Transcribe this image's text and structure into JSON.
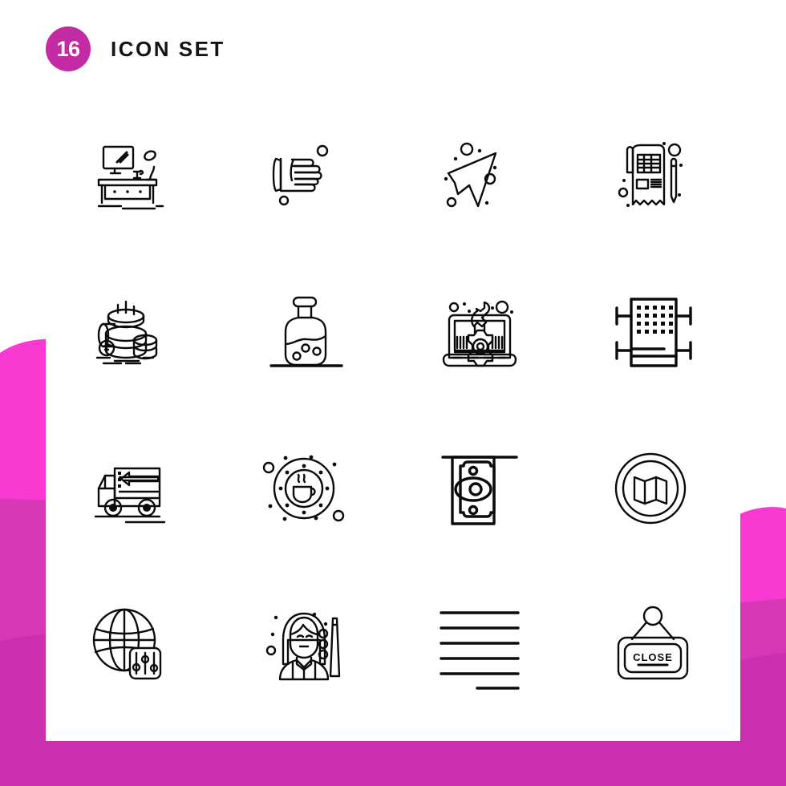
{
  "header": {
    "badge_count": "16",
    "title": "ICON SET"
  },
  "theme": {
    "badge_color": "#c32ba5",
    "accent_bright": "#f83ad2",
    "accent_mid": "#d637b4",
    "accent_deep": "#cc2fae",
    "icon_stroke": "#0b0b0b",
    "card_background": "#ffffff",
    "page_background": "#ffffff"
  },
  "grid": {
    "columns": 4,
    "rows": 4,
    "total": 16
  },
  "icons": [
    {
      "position": 1,
      "row": 1,
      "col": 1,
      "name": "desk-workspace-icon",
      "label": "Desk with monitor and lamp"
    },
    {
      "position": 2,
      "row": 1,
      "col": 2,
      "name": "glove-hand-icon",
      "label": "Glove hand"
    },
    {
      "position": 3,
      "row": 1,
      "col": 3,
      "name": "cursor-arrow-icon",
      "label": "Cursor pointer"
    },
    {
      "position": 4,
      "row": 1,
      "col": 4,
      "name": "invoice-receipt-icon",
      "label": "Invoice receipt with pen"
    },
    {
      "position": 5,
      "row": 2,
      "col": 1,
      "name": "coin-stack-icon",
      "label": "Stack of coins"
    },
    {
      "position": 6,
      "row": 2,
      "col": 2,
      "name": "potion-bottle-icon",
      "label": "Potion bottle"
    },
    {
      "position": 7,
      "row": 2,
      "col": 3,
      "name": "laptop-settings-icon",
      "label": "Laptop with gear and wrench"
    },
    {
      "position": 8,
      "row": 2,
      "col": 4,
      "name": "factory-building-icon",
      "label": "Industrial building"
    },
    {
      "position": 9,
      "row": 3,
      "col": 1,
      "name": "delivery-truck-icon",
      "label": "Delivery truck with arrow"
    },
    {
      "position": 10,
      "row": 3,
      "col": 2,
      "name": "coffee-cup-circle-icon",
      "label": "Coffee cup in circle"
    },
    {
      "position": 11,
      "row": 3,
      "col": 3,
      "name": "banknote-money-icon",
      "label": "Banknote"
    },
    {
      "position": 12,
      "row": 3,
      "col": 4,
      "name": "folded-map-circle-icon",
      "label": "Folded map in circle"
    },
    {
      "position": 13,
      "row": 4,
      "col": 1,
      "name": "globe-settings-icon",
      "label": "Globe with settings sliders"
    },
    {
      "position": 14,
      "row": 4,
      "col": 2,
      "name": "woman-avatar-icon",
      "label": "Female avatar"
    },
    {
      "position": 15,
      "row": 4,
      "col": 3,
      "name": "text-lines-icon",
      "label": "Text alignment lines"
    },
    {
      "position": 16,
      "row": 4,
      "col": 4,
      "name": "close-sign-icon",
      "label": "Hanging close sign",
      "sign_text": "CLOSE"
    }
  ]
}
